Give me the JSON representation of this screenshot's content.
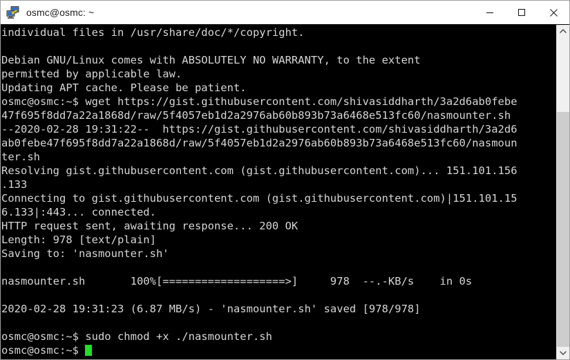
{
  "window": {
    "title": "osmc@osmc: ~",
    "icon": "putty-terminal-icon",
    "buttons": {
      "minimize": "minimize-button",
      "maximize": "maximize-button",
      "close": "close-button"
    }
  },
  "colors": {
    "terminal_background": "#000000",
    "terminal_foreground": "#d6d6d6",
    "cursor": "#22e022",
    "titlebar_background": "#ffffff",
    "scrollbar_track": "#f0f0f0",
    "scrollbar_thumb": "#cdcdcd"
  },
  "terminal": {
    "prompt": "osmc@osmc:~$",
    "cursor_visible": true,
    "lines": [
      "individual files in /usr/share/doc/*/copyright.",
      "",
      "Debian GNU/Linux comes with ABSOLUTELY NO WARRANTY, to the extent",
      "permitted by applicable law.",
      "Updating APT cache. Please be patient.",
      "osmc@osmc:~$ wget https://gist.githubusercontent.com/shivasiddharth/3a2d6ab0febe",
      "47f695f8dd7a22a1868d/raw/5f4057eb1d2a2976ab60b893b73a6468e513fc60/nasmounter.sh",
      "--2020-02-28 19:31:22--  https://gist.githubusercontent.com/shivasiddharth/3a2d6",
      "ab0febe47f695f8dd7a22a1868d/raw/5f4057eb1d2a2976ab60b893b73a6468e513fc60/nasmoun",
      "ter.sh",
      "Resolving gist.githubusercontent.com (gist.githubusercontent.com)... 151.101.156",
      ".133",
      "Connecting to gist.githubusercontent.com (gist.githubusercontent.com)|151.101.15",
      "6.133|:443... connected.",
      "HTTP request sent, awaiting response... 200 OK",
      "Length: 978 [text/plain]",
      "Saving to: 'nasmounter.sh'",
      "",
      "nasmounter.sh       100%[===================>]     978  --.-KB/s    in 0s",
      "",
      "2020-02-28 19:31:23 (6.87 MB/s) - 'nasmounter.sh' saved [978/978]",
      "",
      "osmc@osmc:~$ sudo chmod +x ./nasmounter.sh"
    ],
    "last_line": "osmc@osmc:~$ "
  },
  "scrollbar": {
    "up_arrow": "scroll-up-arrow-icon",
    "down_arrow": "scroll-down-arrow-icon",
    "thumb_top_percent": 24,
    "thumb_height_percent": 76
  }
}
